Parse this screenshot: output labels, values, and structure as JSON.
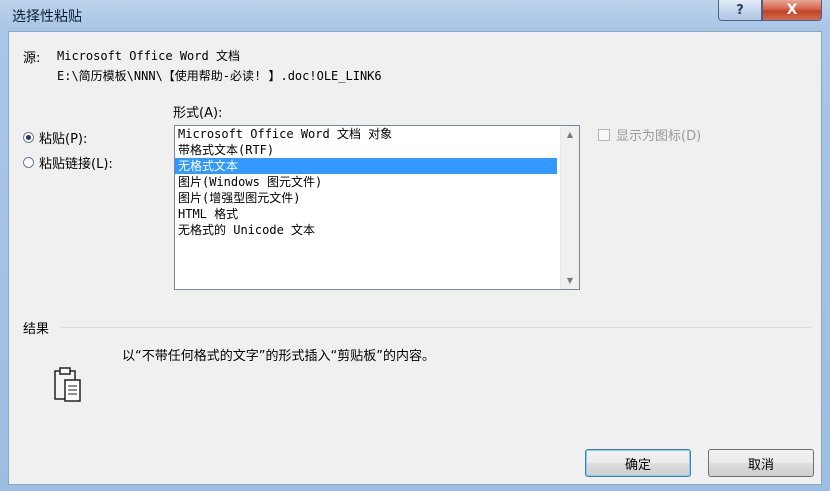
{
  "window": {
    "title": "选择性粘贴",
    "help_label": "?",
    "close_label": "X"
  },
  "source": {
    "label": "源:",
    "line1": "Microsoft Office Word 文档",
    "line2": "E:\\简历模板\\NNN\\【使用帮助-必读! 】.doc!OLE_LINK6"
  },
  "format": {
    "label": "形式(A):",
    "items": [
      "Microsoft Office Word 文档 对象",
      "带格式文本(RTF)",
      "无格式文本",
      "图片(Windows 图元文件)",
      "图片(增强型图元文件)",
      "HTML 格式",
      "无格式的 Unicode 文本"
    ],
    "selected_index": 2
  },
  "options": {
    "paste_label": "粘贴(P):",
    "paste_link_label": "粘贴链接(L):",
    "selected": "paste"
  },
  "show_as_icon": {
    "label": "显示为图标(D)",
    "checked": false,
    "enabled": false
  },
  "result": {
    "label": "结果",
    "text": "以“不带任何格式的文字”的形式插入“剪贴板”的内容。"
  },
  "buttons": {
    "ok": "确定",
    "cancel": "取消"
  },
  "colors": {
    "selection": "#3399ff",
    "close_button": "#c1432a",
    "titlebar": "#bcd3ec"
  }
}
